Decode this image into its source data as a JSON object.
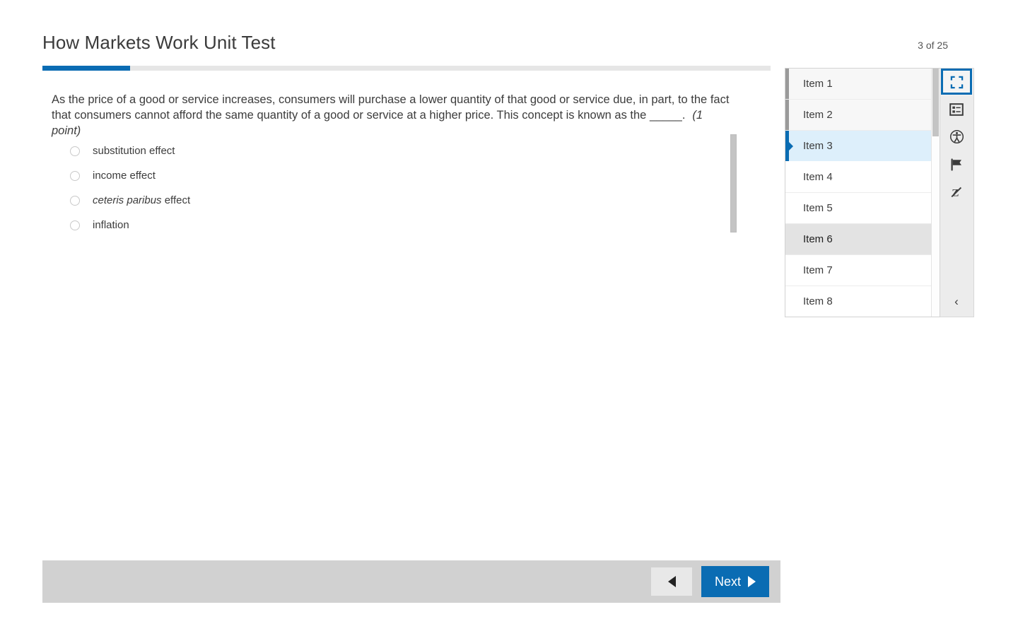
{
  "header": {
    "title": "How Markets Work Unit Test",
    "counter": "3 of 25",
    "progress_percent": 12,
    "accent_color": "#0a6cb3"
  },
  "question": {
    "body": "As the price of a good or service increases, consumers will purchase a lower quantity of that good or service due, in part, to the fact that consumers cannot afford the same quantity of a good or service at a higher price. This concept is known as the _____.",
    "points": "(1 point)",
    "options": [
      {
        "label": "substitution effect",
        "italic_prefix": "",
        "selected": false
      },
      {
        "label": "income effect",
        "italic_prefix": "",
        "selected": false
      },
      {
        "label": " effect",
        "italic_prefix": "ceteris paribus",
        "selected": false
      },
      {
        "label": "inflation",
        "italic_prefix": "",
        "selected": false
      }
    ]
  },
  "item_navigator": {
    "items": [
      {
        "label": "Item 1",
        "state": "answered"
      },
      {
        "label": "Item 2",
        "state": "answered"
      },
      {
        "label": "Item 3",
        "state": "current"
      },
      {
        "label": "Item 4",
        "state": "unanswered"
      },
      {
        "label": "Item 5",
        "state": "unanswered"
      },
      {
        "label": "Item 6",
        "state": "hovered"
      },
      {
        "label": "Item 7",
        "state": "unanswered"
      },
      {
        "label": "Item 8",
        "state": "unanswered"
      }
    ]
  },
  "toolbar": {
    "buttons": [
      {
        "icon": "fullscreen-icon",
        "name": "fullscreen-button",
        "selected": true
      },
      {
        "icon": "item-review-list-icon",
        "name": "item-review-button",
        "selected": false
      },
      {
        "icon": "accessibility-icon",
        "name": "accessibility-button",
        "selected": false
      },
      {
        "icon": "flag-icon",
        "name": "flag-button",
        "selected": false
      },
      {
        "icon": "strikethrough-z-icon",
        "name": "eliminate-choice-button",
        "selected": false
      }
    ],
    "collapse_icon": "chevron-left-icon",
    "collapse_glyph": "‹"
  },
  "footer": {
    "prev_label": "",
    "next_label": "Next"
  }
}
